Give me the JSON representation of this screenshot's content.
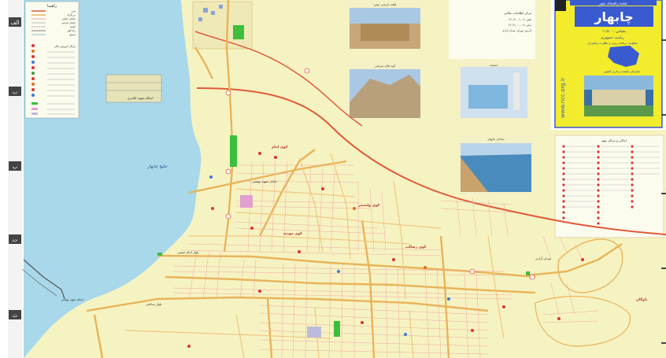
{
  "map": {
    "title": "چابهار",
    "title_top": "نقشه راهنمای شهر",
    "scale": "مقیاس ۱:۱۵۰۰۰",
    "ministry_line1": "ریاست جمهوری",
    "ministry_line2": "معاونت برنامه ریزی و نظارت راهبردی",
    "org_line": "سازمان نقشه برداری کشور",
    "website": "www.ncc.org.ir",
    "sea_label": "خلیج چابهار",
    "port_label": "اسکله شهید کلانتری",
    "port_label2": "اسکله شهید بهشتی",
    "grid_left": [
      "الف",
      "ب",
      "پ",
      "ت",
      "ث"
    ],
    "legend_title": "راهنما",
    "legend_entries": [
      "مرز",
      "بزرگراه",
      "خیابان اصلی",
      "خیابان فرعی",
      "کوچه",
      "راه آهن",
      "مسیل"
    ],
    "legend_pois_title": "مراکز آموزش عالی",
    "places_title": "اماکن و مراکز مهم",
    "info_title": "مرکز اطلاعات مکانی",
    "info_lines": [
      "تلفن ۰۲۱-۶۶۰۷۱۰۰۱",
      "نمابر ۰۲۱-۶۶۰۷۱۰۰۰",
      "آدرس: تهران، میدان آزادی"
    ],
    "photo_caption_1": "قلعه تاریخی تیس",
    "photo_caption_2": "کوه های مریخی",
    "photo_caption_3": "مسجد",
    "photo_caption_4": "ساحل چابهار",
    "district_labels": [
      "کوی امام",
      "کوی ولیعصر",
      "کوی رسالت",
      "کوی مهدیه",
      "ناوگان"
    ],
    "street_labels": [
      "بلوار امام خمینی",
      "خیابان شهید بهشتی",
      "بلوار ساحلی",
      "میدان آزادی"
    ],
    "colors": {
      "sea": "#a8d8ea",
      "land": "#f6f3c2",
      "road_major": "#e8b45a",
      "road_minor": "#f3a6a6",
      "highway": "#e05a3a",
      "park": "#3dbf3d",
      "title_panel": "#f2ec2c",
      "grid_bg": "#444444"
    }
  }
}
